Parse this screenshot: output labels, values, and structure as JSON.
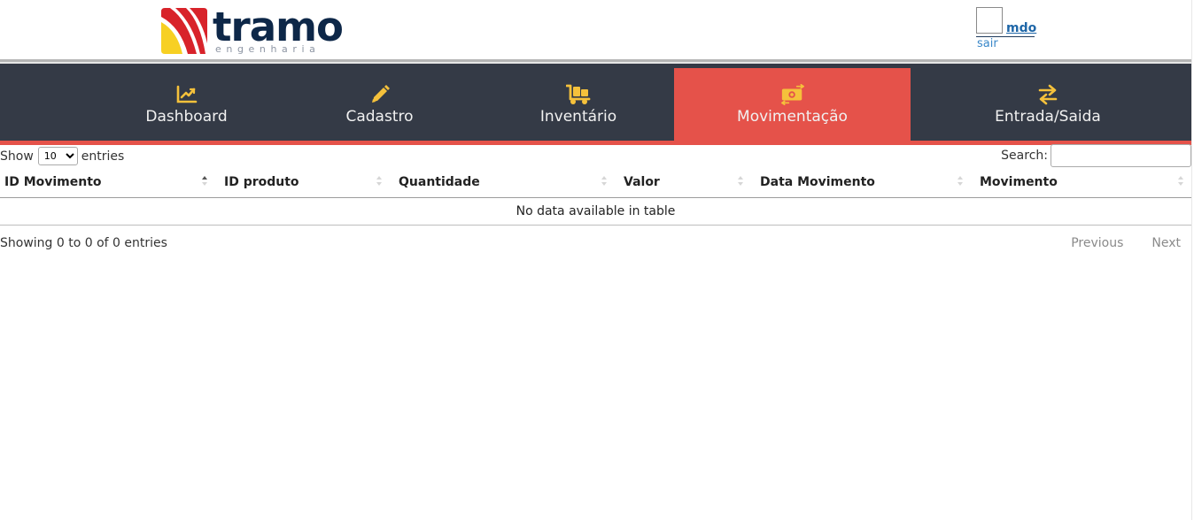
{
  "brand": {
    "name": "tramo",
    "subtitle": "engenharia"
  },
  "user": {
    "name": "mdo",
    "logout": "sair"
  },
  "nav": {
    "items": [
      {
        "label": "Dashboard",
        "icon": "chart-line-icon"
      },
      {
        "label": "Cadastro",
        "icon": "pencil-icon"
      },
      {
        "label": "Inventário",
        "icon": "dolly-icon"
      },
      {
        "label": "Movimentação",
        "icon": "money-exchange-icon",
        "active": true
      },
      {
        "label": "Entrada/Saida",
        "icon": "exchange-arrows-icon"
      }
    ],
    "icon_color": "#f5c13b",
    "background": "#343a46",
    "active_color": "#e5524a"
  },
  "table_controls": {
    "show_prefix": "Show",
    "page_size": "10",
    "page_size_options": [
      "10"
    ],
    "show_suffix": "entries",
    "search_label": "Search:",
    "search_value": ""
  },
  "table": {
    "columns": [
      "ID Movimento",
      "ID produto",
      "Quantidade",
      "Valor",
      "Data Movimento",
      "Movimento"
    ],
    "sorted_column": "ID Movimento",
    "empty_message": "No data available in table"
  },
  "footer": {
    "info": "Showing 0 to 0 of 0 entries",
    "previous": "Previous",
    "next": "Next"
  }
}
